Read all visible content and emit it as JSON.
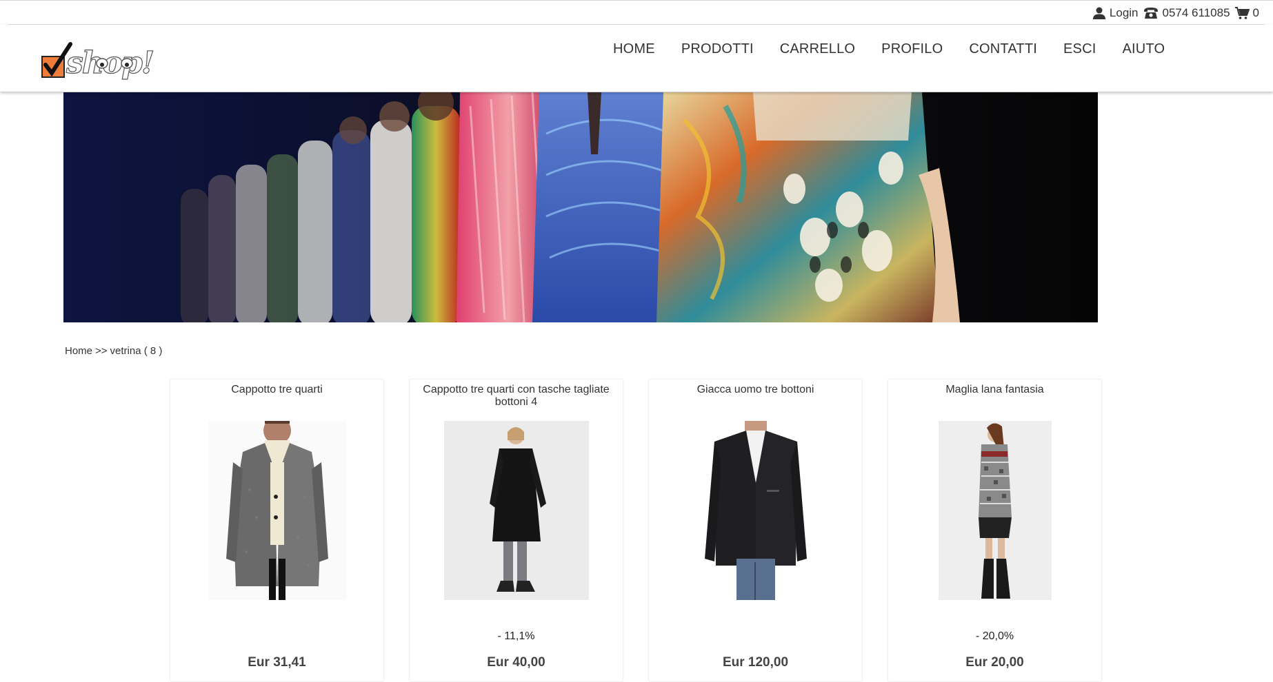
{
  "topbar": {
    "login_label": "Login",
    "phone": "0574 611085",
    "cart_count": "0",
    "icons": [
      "user-icon",
      "phone-icon",
      "cart-icon"
    ]
  },
  "brand": {
    "logo_text": "shop!",
    "accent_color": "#ee7d3b"
  },
  "nav": {
    "items": [
      {
        "label": "HOME"
      },
      {
        "label": "PRODOTTI"
      },
      {
        "label": "CARRELLO"
      },
      {
        "label": "PROFILO"
      },
      {
        "label": "CONTATTI"
      },
      {
        "label": "ESCI"
      },
      {
        "label": "AIUTO"
      }
    ]
  },
  "breadcrumb": {
    "home": "Home",
    "separator": ">>",
    "current": "vetrina ( 8 )"
  },
  "products": [
    {
      "title": "Cappotto tre quarti",
      "discount": "",
      "price": "Eur 31,41"
    },
    {
      "title": "Cappotto tre quarti con tasche tagliate bottoni 4",
      "discount": "- 11,1%",
      "price": "Eur 40,00"
    },
    {
      "title": "Giacca uomo tre bottoni",
      "discount": "",
      "price": "Eur 120,00"
    },
    {
      "title": "Maglia lana fantasia",
      "discount": "- 20,0%",
      "price": "Eur 20,00"
    }
  ]
}
